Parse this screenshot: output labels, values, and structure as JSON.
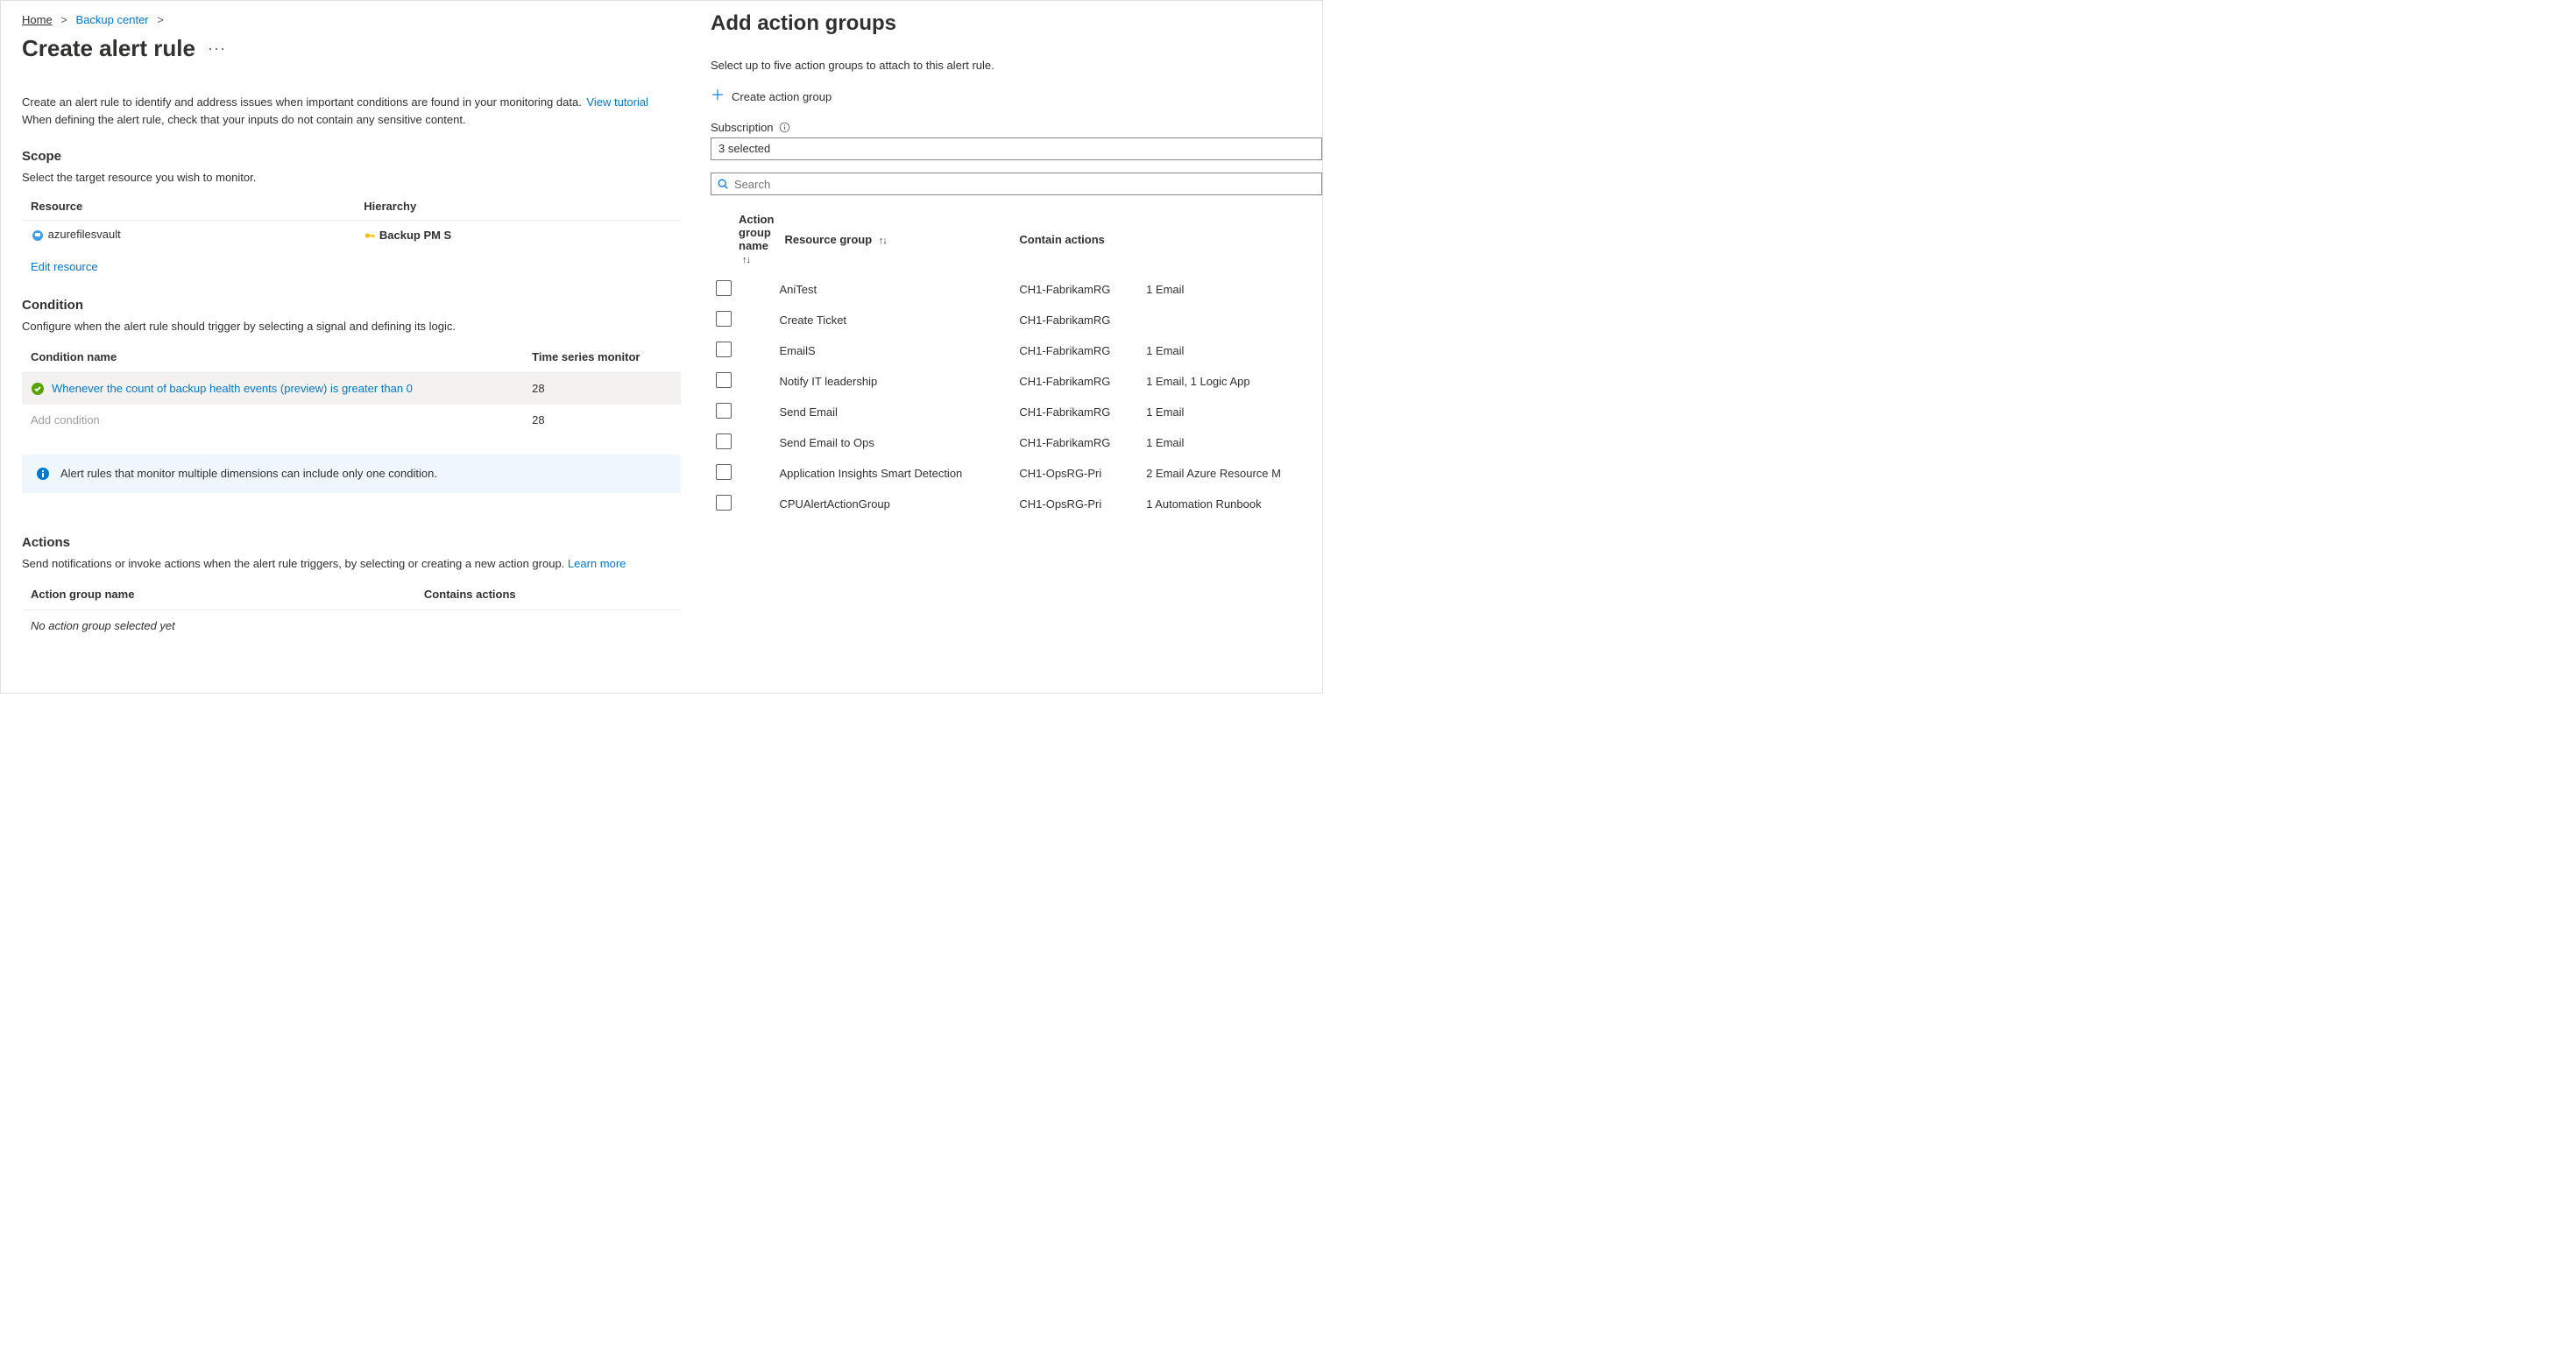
{
  "breadcrumb": {
    "items": [
      "Home",
      "Backup center"
    ]
  },
  "page": {
    "title": "Create alert rule",
    "intro_prefix": "Create an alert rule to identify and address issues when important conditions are found in your monitoring data. ",
    "intro_link": "View tutorial",
    "intro_line2": "When defining the alert rule, check that your inputs do not contain any sensitive content."
  },
  "scope": {
    "heading": "Scope",
    "sub": "Select the target resource you wish to monitor.",
    "columns": {
      "resource": "Resource",
      "hierarchy": "Hierarchy"
    },
    "rows": [
      {
        "resource": "azurefilesvault",
        "hierarchy": "Backup PM S"
      }
    ],
    "edit_link": "Edit resource"
  },
  "condition": {
    "heading": "Condition",
    "sub": "Configure when the alert rule should trigger by selecting a signal and defining its logic.",
    "columns": {
      "name": "Condition name",
      "ts": "Time series monitor"
    },
    "rows": [
      {
        "name": "Whenever the count of backup health events (preview) is greater than 0",
        "ts": "28"
      }
    ],
    "add_placeholder": "Add condition",
    "add_ts": "28",
    "info": "Alert rules that monitor multiple dimensions can include only one condition."
  },
  "actions": {
    "heading": "Actions",
    "sub_prefix": "Send notifications or invoke actions when the alert rule triggers, by selecting or creating a new action group. ",
    "learn_more": "Learn more",
    "columns": {
      "name": "Action group name",
      "contains": "Contains actions"
    },
    "empty": "No action group selected yet"
  },
  "side": {
    "title": "Add action groups",
    "sub": "Select up to five action groups to attach to this alert rule.",
    "create_link": "Create action group",
    "subscription_label": "Subscription",
    "subscription_value": "3 selected",
    "search_placeholder": "Search",
    "columns": {
      "name": "Action group name",
      "rg": "Resource group",
      "actions": "Contain actions"
    },
    "rows": [
      {
        "name": "AniTest",
        "rg": "CH1-FabrikamRG",
        "actions": "1 Email"
      },
      {
        "name": "Create Ticket",
        "rg": "CH1-FabrikamRG",
        "actions": ""
      },
      {
        "name": "EmailS",
        "rg": "CH1-FabrikamRG",
        "actions": "1 Email"
      },
      {
        "name": "Notify IT leadership",
        "rg": "CH1-FabrikamRG",
        "actions": "1 Email, 1 Logic App"
      },
      {
        "name": "Send Email",
        "rg": "CH1-FabrikamRG",
        "actions": "1 Email"
      },
      {
        "name": "Send Email to Ops",
        "rg": "CH1-FabrikamRG",
        "actions": "1 Email"
      },
      {
        "name": "Application Insights Smart Detection",
        "rg": "CH1-OpsRG-Pri",
        "actions": "2 Email Azure Resource M"
      },
      {
        "name": "CPUAlertActionGroup",
        "rg": "CH1-OpsRG-Pri",
        "actions": "1 Automation Runbook"
      }
    ]
  }
}
